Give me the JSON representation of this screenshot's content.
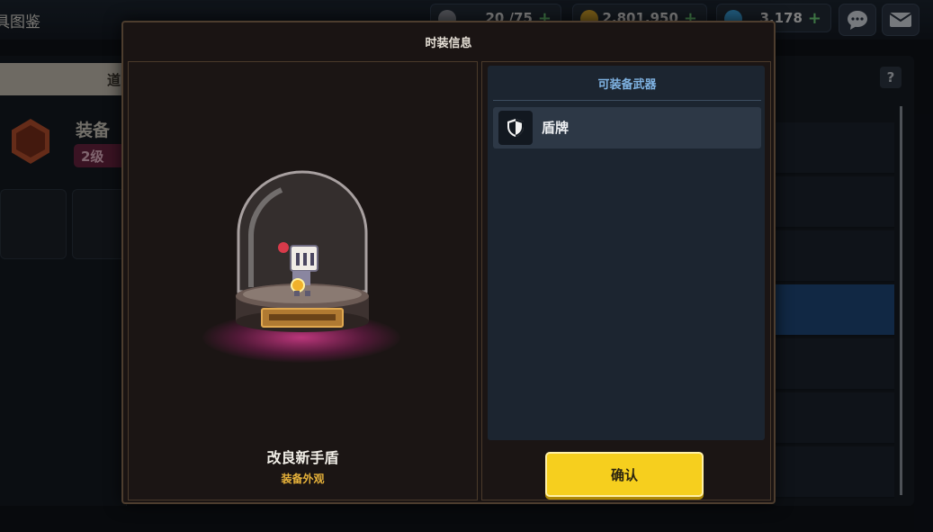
{
  "background": {
    "page_title": "具图鉴",
    "resources": [
      {
        "icon": "coffee-icon",
        "value": "20 /75",
        "color": "#8a8f97"
      },
      {
        "icon": "gold-coin-icon",
        "value": "2,801,950",
        "color": "#d6a52a"
      },
      {
        "icon": "gem-icon",
        "value": "3,178",
        "color": "#3ba4e0"
      }
    ],
    "tab_label": "道",
    "equip_title": "装备",
    "level_label": "2级",
    "help_label": "?"
  },
  "modal": {
    "title": "时装信息",
    "costume": {
      "name": "改良新手盾",
      "type": "装备外观"
    },
    "weapons": {
      "header": "可装备武器",
      "items": [
        {
          "label": "盾牌",
          "icon": "shield-icon"
        }
      ]
    },
    "confirm_label": "确认"
  },
  "colors": {
    "accent_yellow": "#f6cf1e",
    "header_blue": "#7fb3e3",
    "type_gold": "#e7b23a"
  }
}
